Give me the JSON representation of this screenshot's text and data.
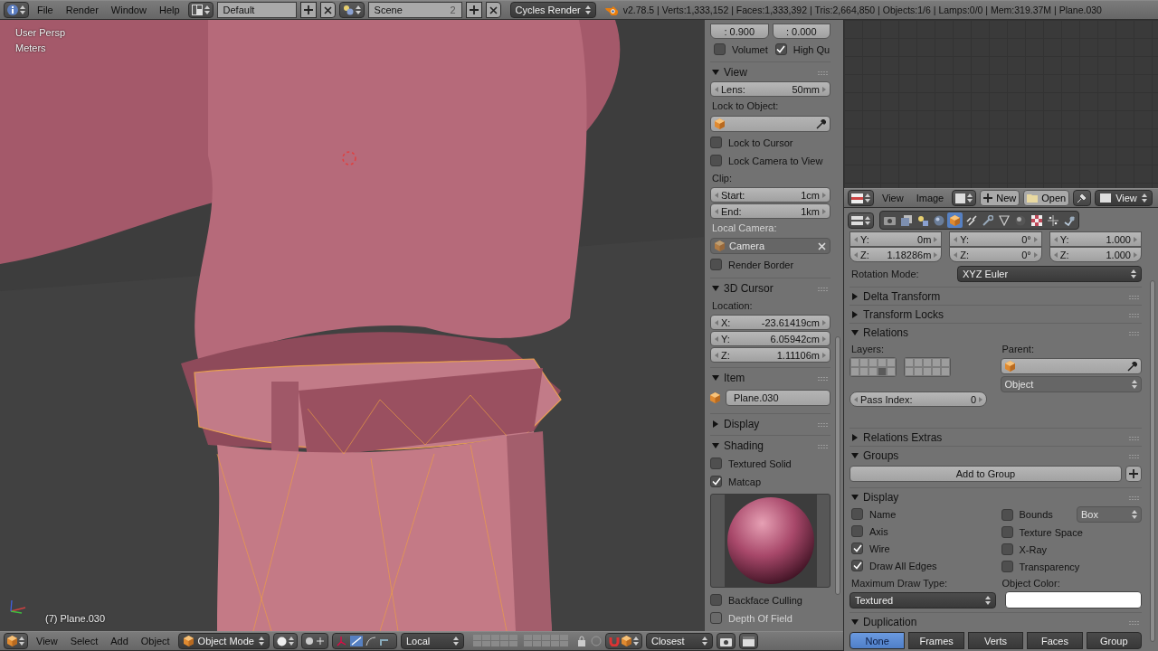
{
  "top_bar": {
    "menus": [
      "File",
      "Render",
      "Window",
      "Help"
    ],
    "layout": "Default",
    "scene": "Scene",
    "scene_users": "2",
    "engine": "Cycles Render",
    "stats": "v2.78.5 | Verts:1,333,152 | Faces:1,333,392 | Tris:2,664,850 | Objects:1/6 | Lamps:0/0 | Mem:319.37M | Plane.030"
  },
  "viewport": {
    "view_name": "User Persp",
    "units": "Meters",
    "object_label": "(7) Plane.030"
  },
  "n_panel": {
    "top_values": [
      ": 0.900",
      ": 0.000"
    ],
    "top_checks": [
      {
        "label": "Volumet",
        "checked": false
      },
      {
        "label": "High Qu",
        "checked": true
      }
    ],
    "sections": [
      {
        "title": "View",
        "expanded": true,
        "rows": [
          {
            "kind": "number",
            "label": "Lens:",
            "value": "50mm"
          },
          {
            "kind": "caption",
            "text": "Lock to Object:",
            "disabled": false
          },
          {
            "kind": "object_field",
            "disabled": false
          },
          {
            "kind": "checkbox",
            "label": "Lock to Cursor",
            "checked": false,
            "disabled": false
          },
          {
            "kind": "checkbox",
            "label": "Lock Camera to View",
            "checked": false,
            "disabled": false
          },
          {
            "kind": "caption",
            "text": "Clip:",
            "disabled": false
          },
          {
            "kind": "number",
            "label": "Start:",
            "value": "1cm"
          },
          {
            "kind": "number",
            "label": "End:",
            "value": "1km"
          },
          {
            "kind": "caption",
            "text": "Local Camera:",
            "disabled": true
          },
          {
            "kind": "object_field",
            "value": "Camera",
            "disabled": true
          },
          {
            "kind": "checkbox",
            "label": "Render Border",
            "checked": false,
            "disabled": false
          }
        ]
      },
      {
        "title": "3D Cursor",
        "expanded": true,
        "rows": [
          {
            "kind": "caption",
            "text": "Location:",
            "disabled": false
          },
          {
            "kind": "number",
            "label": "X:",
            "value": "-23.61419cm"
          },
          {
            "kind": "number",
            "label": "Y:",
            "value": "6.05942cm"
          },
          {
            "kind": "number",
            "label": "Z:",
            "value": "1.11106m"
          }
        ]
      },
      {
        "title": "Item",
        "expanded": true,
        "rows": [
          {
            "kind": "name_field",
            "value": "Plane.030"
          }
        ]
      },
      {
        "title": "Display",
        "expanded": false
      },
      {
        "title": "Shading",
        "expanded": true,
        "rows": [
          {
            "kind": "checkbox",
            "label": "Textured Solid",
            "checked": false,
            "disabled": false
          },
          {
            "kind": "checkbox",
            "label": "Matcap",
            "checked": true,
            "disabled": false
          },
          {
            "kind": "matcap"
          },
          {
            "kind": "checkbox",
            "label": "Backface Culling",
            "checked": false,
            "disabled": false
          },
          {
            "kind": "checkbox",
            "label": "Depth Of Field",
            "checked": false,
            "disabled": true
          }
        ]
      }
    ]
  },
  "image_editor": {
    "menus": [
      "View",
      "Image"
    ],
    "buttons": [
      "New",
      "Open"
    ],
    "view_menu": "View"
  },
  "properties": {
    "tabs": [
      {
        "kind": "render",
        "selected": false
      },
      {
        "kind": "layers",
        "selected": false
      },
      {
        "kind": "scene",
        "selected": false
      },
      {
        "kind": "world",
        "selected": false
      },
      {
        "kind": "object",
        "selected": true
      },
      {
        "kind": "constraints",
        "selected": false
      },
      {
        "kind": "modifiers",
        "selected": false
      },
      {
        "kind": "data",
        "selected": false
      },
      {
        "kind": "material",
        "selected": false
      },
      {
        "kind": "texture",
        "selected": false
      },
      {
        "kind": "particles",
        "selected": false
      },
      {
        "kind": "physics",
        "selected": false
      }
    ],
    "transform_rows": [
      {
        "cells": [
          {
            "label": "Y:",
            "value": "0m"
          },
          {
            "label": "Y:",
            "value": "0°"
          },
          {
            "label": "Y:",
            "value": "1.000"
          }
        ]
      },
      {
        "cells": [
          {
            "label": "Z:",
            "value": "1.18286m"
          },
          {
            "label": "Z:",
            "value": "0°"
          },
          {
            "label": "Z:",
            "value": "1.000"
          }
        ]
      }
    ],
    "rotation_mode": {
      "label": "Rotation Mode:",
      "value": "XYZ Euler"
    },
    "sections": [
      {
        "title": "Delta Transform",
        "expanded": false
      },
      {
        "title": "Transform Locks",
        "expanded": false
      },
      {
        "kind": "relations",
        "title": "Relations",
        "expanded": true,
        "layers_label": "Layers:",
        "parent_label": "Parent:",
        "parent_type": "Object",
        "pass_label": "Pass Index:",
        "pass_value": "0",
        "layers": [
          {
            "selected": false
          },
          {
            "selected": false
          },
          {
            "selected": false
          },
          {
            "selected": false
          },
          {
            "selected": false
          },
          {
            "selected": false
          },
          {
            "selected": false
          },
          {
            "selected": false
          },
          {
            "selected": true
          },
          {
            "selected": false
          },
          {
            "selected": false
          },
          {
            "selected": false
          },
          {
            "selected": false
          },
          {
            "selected": false
          },
          {
            "selected": false
          },
          {
            "selected": false
          },
          {
            "selected": false
          },
          {
            "selected": false
          },
          {
            "selected": false
          },
          {
            "selected": false
          }
        ]
      },
      {
        "title": "Relations Extras",
        "expanded": false
      },
      {
        "kind": "groups",
        "title": "Groups",
        "expanded": true,
        "button": "Add to Group"
      },
      {
        "kind": "display",
        "title": "Display",
        "expanded": true,
        "left": [
          {
            "label": "Name",
            "checked": false
          },
          {
            "label": "Axis",
            "checked": false
          },
          {
            "label": "Wire",
            "checked": true
          },
          {
            "label": "Draw All Edges",
            "checked": true
          }
        ],
        "right": [
          {
            "label": "Bounds",
            "checked": false
          },
          {
            "label": "Texture Space",
            "checked": false
          },
          {
            "label": "X-Ray",
            "checked": false
          },
          {
            "label": "Transparency",
            "checked": false
          }
        ],
        "bounds_type": "Box",
        "draw_type_label": "Maximum Draw Type:",
        "draw_type": "Textured",
        "color_label": "Object Color:"
      },
      {
        "kind": "duplication",
        "title": "Duplication",
        "expanded": true,
        "options": [
          {
            "label": "None",
            "selected": true
          },
          {
            "label": "Frames",
            "selected": false
          },
          {
            "label": "Verts",
            "selected": false
          },
          {
            "label": "Faces",
            "selected": false
          },
          {
            "label": "Group",
            "selected": false
          }
        ]
      }
    ]
  },
  "bottom_bar": {
    "menus": [
      "View",
      "Select",
      "Add",
      "Object"
    ],
    "mode": "Object Mode",
    "pivot": "Local",
    "snap": "Closest"
  }
}
